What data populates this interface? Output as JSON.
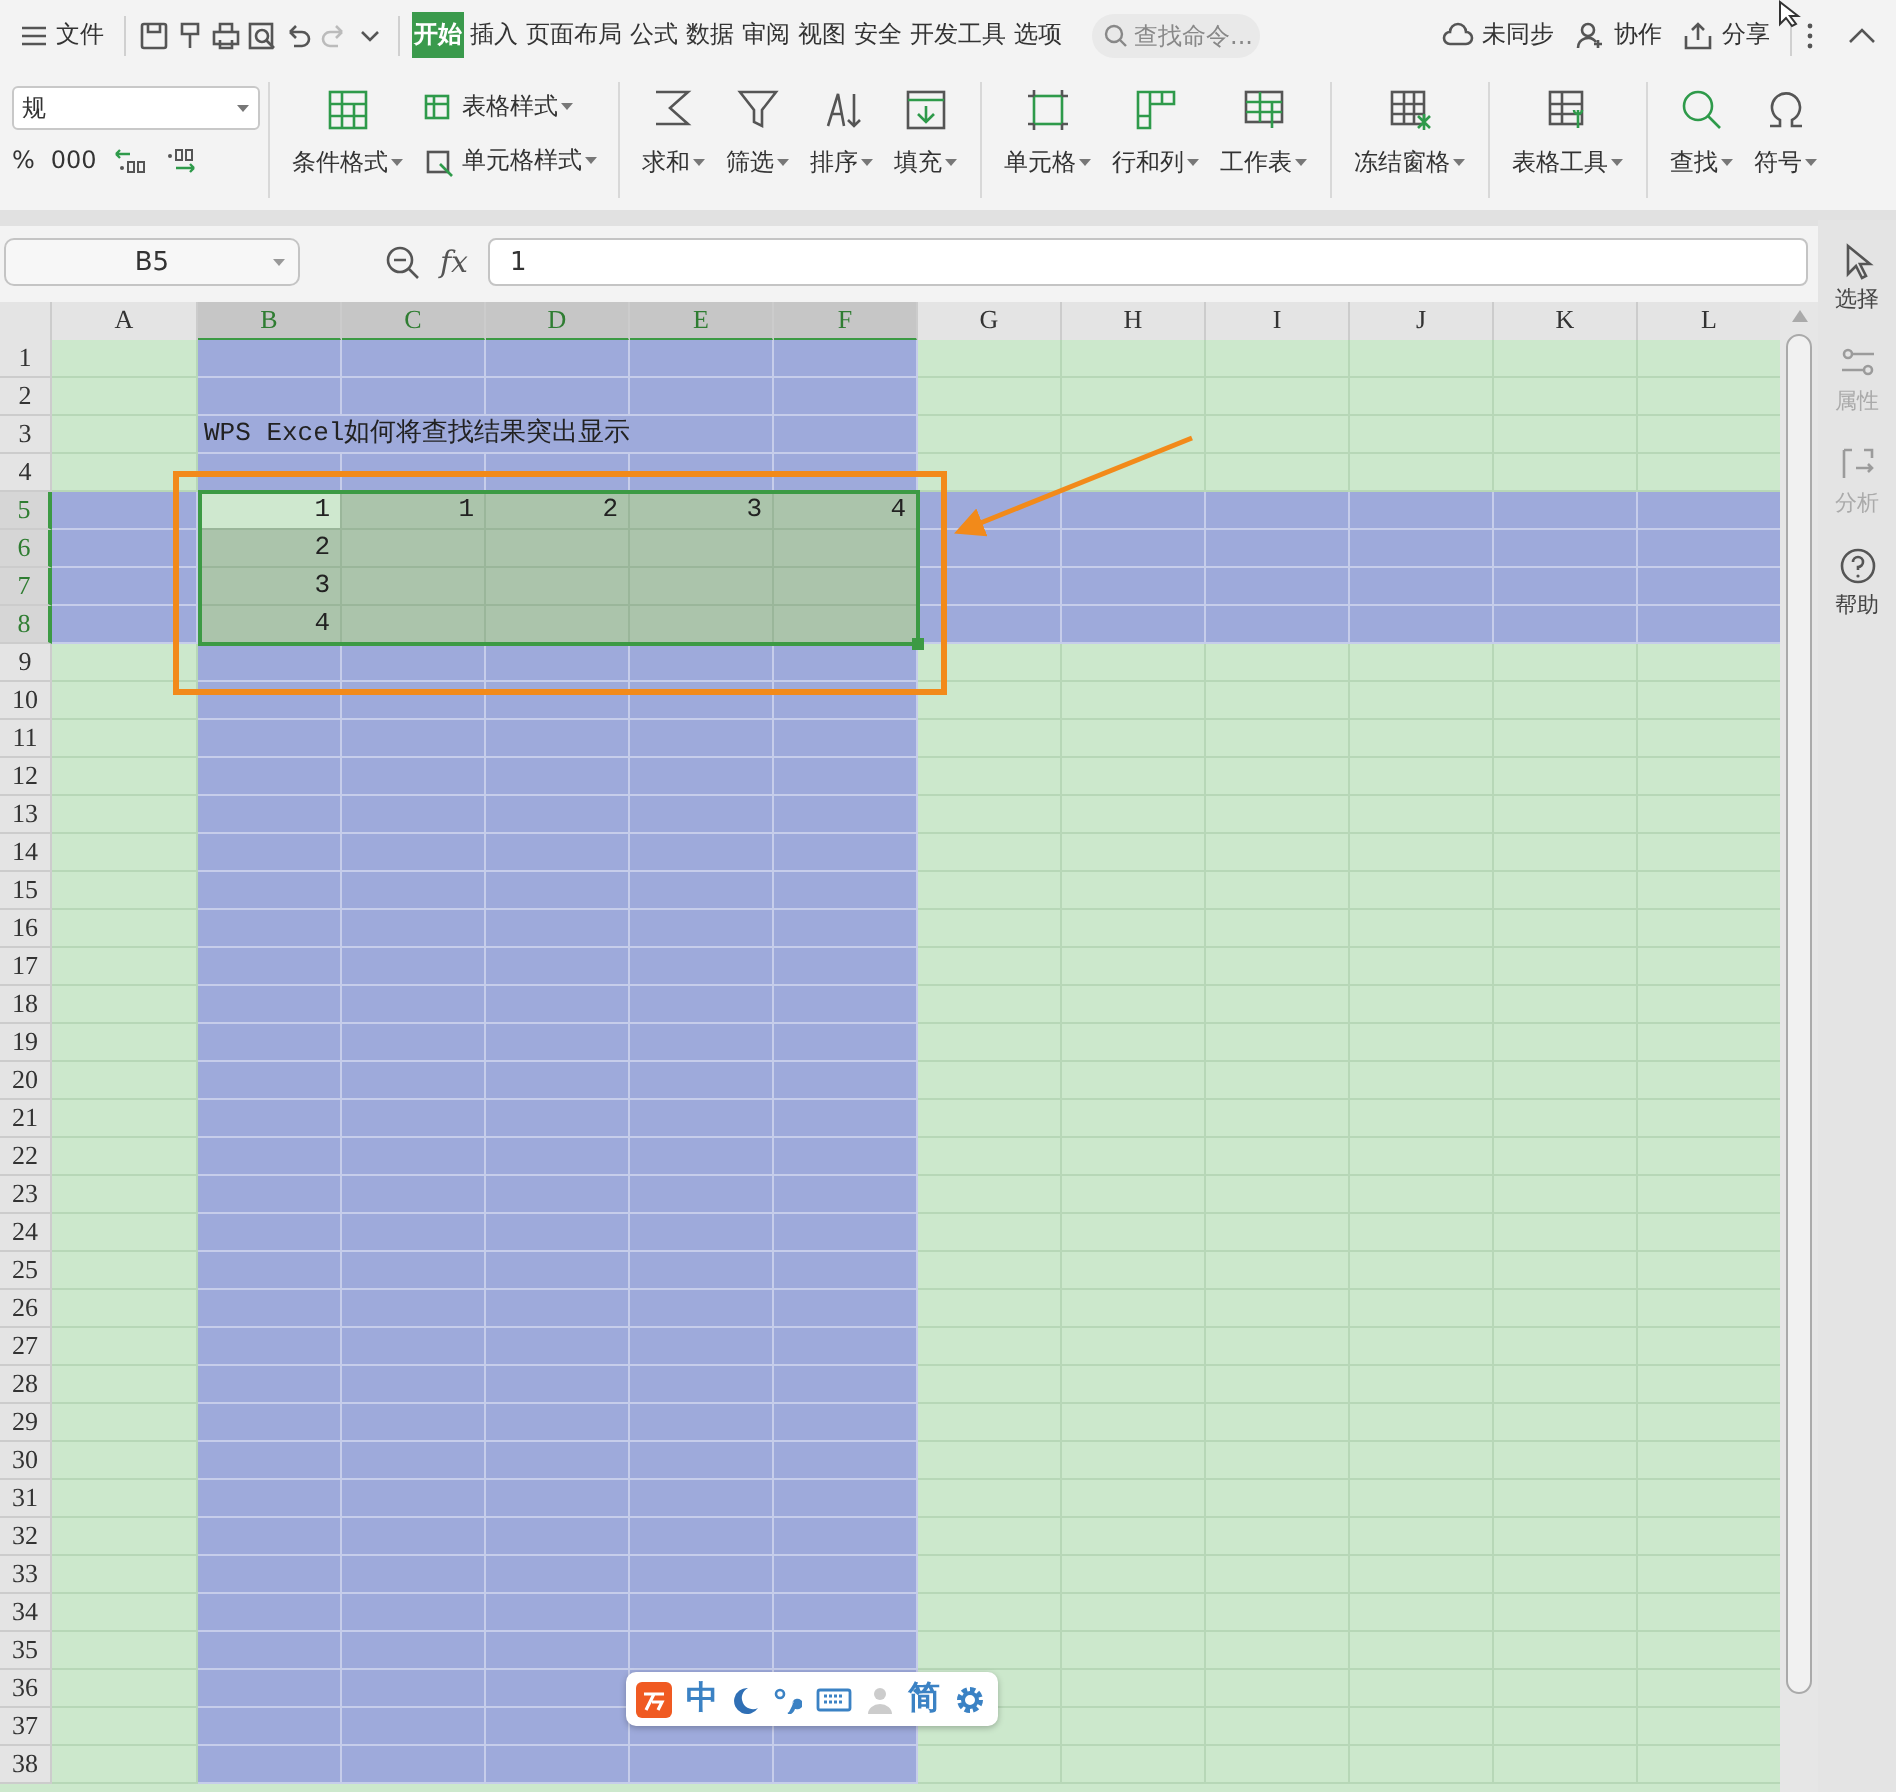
{
  "menu_bar": {
    "file_label": "文件",
    "tabs": [
      {
        "label": "开始",
        "selected": true
      },
      {
        "label": "插入",
        "selected": false
      },
      {
        "label": "页面布局",
        "selected": false
      },
      {
        "label": "公式",
        "selected": false
      },
      {
        "label": "数据",
        "selected": false
      },
      {
        "label": "审阅",
        "selected": false
      },
      {
        "label": "视图",
        "selected": false
      },
      {
        "label": "安全",
        "selected": false
      },
      {
        "label": "开发工具",
        "selected": false
      },
      {
        "label": "选项",
        "selected": false
      }
    ],
    "search": {
      "placeholder": "查找命令..."
    },
    "actions": [
      "未同步",
      "协作",
      "分享"
    ]
  },
  "ribbon": {
    "number_format": {
      "value": "规"
    },
    "number_buttons": [
      "%",
      "000"
    ],
    "groups": [
      [
        {
          "kind": "large",
          "label": "条件格式",
          "dropdown": true
        },
        {
          "kind": "small",
          "label": "表格样式",
          "dropdown": true
        },
        {
          "kind": "small",
          "label": "单元格样式",
          "dropdown": true
        }
      ],
      [
        {
          "kind": "large",
          "label": "求和",
          "dropdown": true
        },
        {
          "kind": "large",
          "label": "筛选",
          "dropdown": true
        },
        {
          "kind": "large",
          "label": "排序",
          "dropdown": true
        },
        {
          "kind": "large",
          "label": "填充",
          "dropdown": true
        }
      ],
      [
        {
          "kind": "large",
          "label": "单元格",
          "dropdown": true
        },
        {
          "kind": "large",
          "label": "行和列",
          "dropdown": true
        },
        {
          "kind": "large",
          "label": "工作表",
          "dropdown": true
        }
      ],
      [
        {
          "kind": "large",
          "label": "冻结窗格",
          "dropdown": true
        }
      ],
      [
        {
          "kind": "large",
          "label": "表格工具",
          "dropdown": true
        }
      ],
      [
        {
          "kind": "large",
          "label": "查找",
          "dropdown": true
        },
        {
          "kind": "large",
          "label": "符号",
          "dropdown": true
        }
      ]
    ]
  },
  "formula_bar": {
    "name_box": "B5",
    "fx_label": "fx",
    "value": "1"
  },
  "sheet": {
    "columns": [
      {
        "label": "A",
        "selected": false
      },
      {
        "label": "B",
        "selected": true
      },
      {
        "label": "C",
        "selected": true
      },
      {
        "label": "D",
        "selected": true
      },
      {
        "label": "E",
        "selected": true
      },
      {
        "label": "F",
        "selected": true
      },
      {
        "label": "G",
        "selected": false
      },
      {
        "label": "H",
        "selected": false
      },
      {
        "label": "I",
        "selected": false
      },
      {
        "label": "J",
        "selected": false
      },
      {
        "label": "K",
        "selected": false
      },
      {
        "label": "L",
        "selected": false
      }
    ],
    "rows": [
      {
        "label": "1",
        "selected": false,
        "cells": []
      },
      {
        "label": "2",
        "selected": false,
        "cells": []
      },
      {
        "label": "3",
        "selected": false,
        "cells": [
          {
            "text": "WPS Excel如何将查找结果突出显示",
            "kind": "text",
            "active": false
          }
        ]
      },
      {
        "label": "4",
        "selected": false,
        "cells": []
      },
      {
        "label": "5",
        "selected": true,
        "cells": [
          {
            "text": "1",
            "kind": "number",
            "active": true
          },
          {
            "text": "1",
            "kind": "number",
            "active": false
          },
          {
            "text": "2",
            "kind": "number",
            "active": false
          },
          {
            "text": "3",
            "kind": "number",
            "active": false
          },
          {
            "text": "4",
            "kind": "number",
            "active": false
          }
        ]
      },
      {
        "label": "6",
        "selected": true,
        "cells": [
          {
            "text": "2",
            "kind": "number",
            "active": false
          }
        ]
      },
      {
        "label": "7",
        "selected": true,
        "cells": [
          {
            "text": "3",
            "kind": "number",
            "active": false
          }
        ]
      },
      {
        "label": "8",
        "selected": true,
        "cells": [
          {
            "text": "4",
            "kind": "number",
            "active": false
          }
        ]
      },
      {
        "label": "9",
        "selected": false,
        "cells": []
      },
      {
        "label": "10",
        "selected": false,
        "cells": []
      },
      {
        "label": "11",
        "selected": false,
        "cells": []
      },
      {
        "label": "12",
        "selected": false,
        "cells": []
      },
      {
        "label": "13",
        "selected": false,
        "cells": []
      },
      {
        "label": "14",
        "selected": false,
        "cells": []
      },
      {
        "label": "15",
        "selected": false,
        "cells": []
      },
      {
        "label": "16",
        "selected": false,
        "cells": []
      },
      {
        "label": "17",
        "selected": false,
        "cells": []
      },
      {
        "label": "18",
        "selected": false,
        "cells": []
      },
      {
        "label": "19",
        "selected": false,
        "cells": []
      },
      {
        "label": "20",
        "selected": false,
        "cells": []
      },
      {
        "label": "21",
        "selected": false,
        "cells": []
      },
      {
        "label": "22",
        "selected": false,
        "cells": []
      },
      {
        "label": "23",
        "selected": false,
        "cells": []
      },
      {
        "label": "24",
        "selected": false,
        "cells": []
      },
      {
        "label": "25",
        "selected": false,
        "cells": []
      },
      {
        "label": "26",
        "selected": false,
        "cells": []
      },
      {
        "label": "27",
        "selected": false,
        "cells": []
      },
      {
        "label": "28",
        "selected": false,
        "cells": []
      },
      {
        "label": "29",
        "selected": false,
        "cells": []
      },
      {
        "label": "30",
        "selected": false,
        "cells": []
      },
      {
        "label": "31",
        "selected": false,
        "cells": []
      },
      {
        "label": "32",
        "selected": false,
        "cells": []
      },
      {
        "label": "33",
        "selected": false,
        "cells": []
      },
      {
        "label": "34",
        "selected": false,
        "cells": []
      },
      {
        "label": "35",
        "selected": false,
        "cells": []
      },
      {
        "label": "36",
        "selected": false,
        "cells": []
      },
      {
        "label": "37",
        "selected": false,
        "cells": []
      },
      {
        "label": "38",
        "selected": false,
        "cells": []
      }
    ]
  },
  "side_panel": [
    {
      "label": "选择",
      "disabled": false
    },
    {
      "label": "属性",
      "disabled": true
    },
    {
      "label": "分析",
      "disabled": true
    },
    {
      "label": "帮助",
      "disabled": false
    }
  ],
  "ime_toolbar": {
    "language": "中",
    "script": "简"
  }
}
